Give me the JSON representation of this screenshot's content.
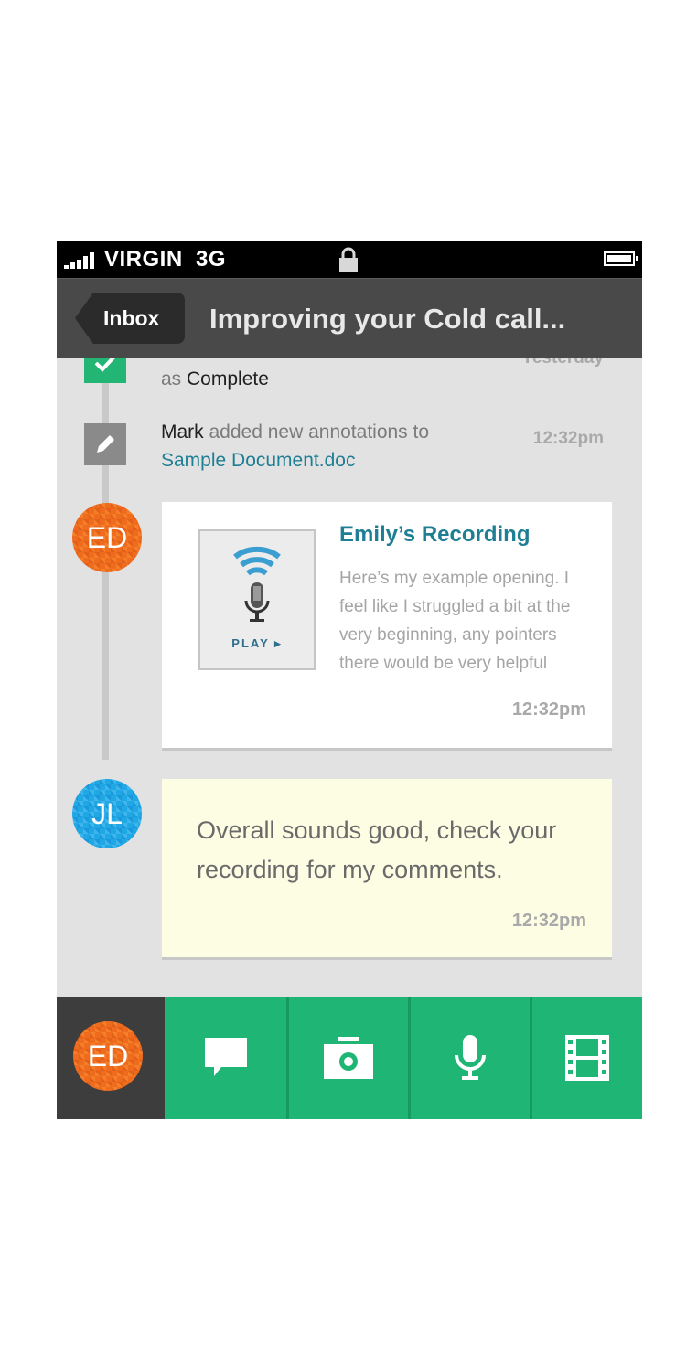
{
  "status_bar": {
    "carrier": "VIRGIN",
    "network": "3G"
  },
  "nav": {
    "back_label": "Inbox",
    "title": "Improving your Cold call..."
  },
  "timeline": {
    "events": [
      {
        "icon": "check-icon",
        "text_prefix": "as ",
        "text_strong": "Complete",
        "time": "Yesterday"
      },
      {
        "icon": "pencil-icon",
        "actor": "Mark",
        "action": " added new annotations to",
        "link": "Sample Document.doc",
        "time": "12:32pm"
      }
    ],
    "recording_card": {
      "avatar_initials": "ED",
      "play_label": "PLAY",
      "title": "Emily’s Recording",
      "body": "Here’s my example opening. I feel like I struggled a bit at the very beginning, any pointers there would be very helpful",
      "time": "12:32pm"
    },
    "note_card": {
      "avatar_initials": "JL",
      "text": "Overall sounds good, check your recording for my comments.",
      "time": "12:32pm"
    }
  },
  "toolbar": {
    "avatar_initials": "ED",
    "buttons": [
      "comment-icon",
      "camera-icon",
      "microphone-icon",
      "film-icon"
    ]
  },
  "colors": {
    "accent_green": "#1fb675",
    "link_teal": "#1e7f94",
    "avatar_orange": "#ef6c1f",
    "avatar_blue": "#1fa8e4",
    "note_yellow": "#fdfde4",
    "nav_gray": "#494949"
  }
}
